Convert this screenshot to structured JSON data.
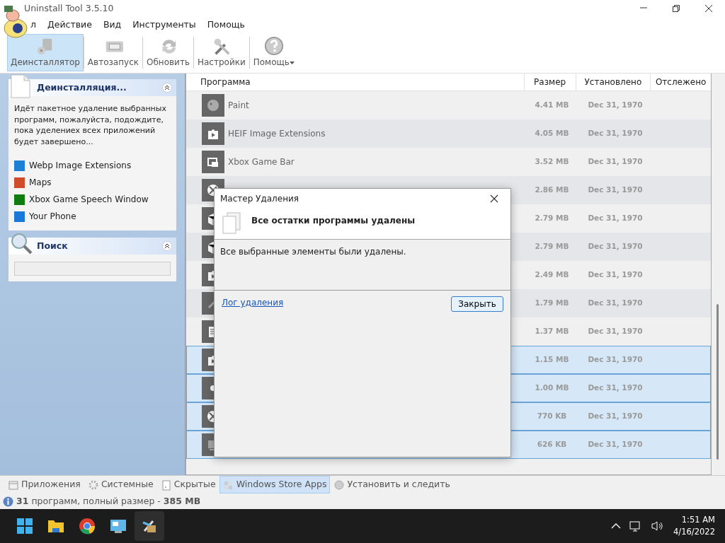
{
  "window": {
    "title": "Uninstall Tool 3.5.10"
  },
  "menu": [
    "л",
    "Действие",
    "Вид",
    "Инструменты",
    "Помощь"
  ],
  "toolbar": [
    {
      "label": "Деинсталлятор",
      "kind": "uninstaller",
      "selected": true
    },
    {
      "label": "Автозапуск",
      "kind": "autorun",
      "selected": false
    },
    {
      "label": "Обновить",
      "kind": "refresh",
      "selected": false
    },
    {
      "label": "Настройки",
      "kind": "settings",
      "selected": false
    },
    {
      "label": "Помощь",
      "kind": "help",
      "selected": false,
      "dropdown": true
    }
  ],
  "sidebar": {
    "progress_panel": {
      "title": "Деинсталляция...",
      "message": "Идёт пакетное удаление выбранных программ, пожалуйста, подождите, пока уделениех всех приложений будет завершено...",
      "items": [
        {
          "name": "Webp Image Extensions",
          "color": "#1e7fd6"
        },
        {
          "name": "Maps",
          "color": "#d04a2c"
        },
        {
          "name": "Xbox Game Speech Window",
          "color": "#107c10"
        },
        {
          "name": "Your Phone",
          "color": "#1a78d6"
        }
      ]
    },
    "search_panel": {
      "title": "Поиск"
    }
  },
  "table": {
    "columns": [
      "Программа",
      "Размер",
      "Установлено",
      "Отслежено"
    ],
    "rows": [
      {
        "kind": "palette",
        "name": "Paint",
        "size": "4.41 MB",
        "installed": "Dec 31, 1970",
        "selected": false
      },
      {
        "kind": "puzzle",
        "name": "HEIF Image Extensions",
        "size": "4.05 MB",
        "installed": "Dec 31, 1970",
        "selected": false
      },
      {
        "kind": "gamebar",
        "name": "Xbox Game Bar",
        "size": "3.52 MB",
        "installed": "Dec 31, 1970",
        "selected": false
      },
      {
        "kind": "xbox",
        "size": "2.86 MB",
        "installed": "Dec 31, 1970",
        "selected": false
      },
      {
        "kind": "box",
        "size": "2.79 MB",
        "installed": "Dec 31, 1970",
        "selected": false
      },
      {
        "kind": "box",
        "size": "2.79 MB",
        "installed": "Dec 31, 1970",
        "selected": false
      },
      {
        "kind": "puzzle",
        "size": "2.49 MB",
        "installed": "Dec 31, 1970",
        "selected": false
      },
      {
        "kind": "tool",
        "size": "1.79 MB",
        "installed": "Dec 31, 1970",
        "selected": false
      },
      {
        "kind": "notes",
        "size": "1.37 MB",
        "installed": "Dec 31, 1970",
        "selected": false
      },
      {
        "kind": "puzzle",
        "size": "1.15 MB",
        "installed": "Dec 31, 1970",
        "selected": true
      },
      {
        "kind": "dot",
        "size": "1.00 MB",
        "installed": "Dec 31, 1970",
        "selected": true
      },
      {
        "kind": "xbox",
        "size": "770 KB",
        "installed": "Dec 31, 1970",
        "selected": true
      },
      {
        "kind": "screen",
        "size": "626 KB",
        "installed": "Dec 31, 1970",
        "selected": true
      }
    ]
  },
  "dialog": {
    "title": "Мастер Удаления",
    "heading": "Все остатки программы удалены",
    "message": "Все выбранные элементы были удалены.",
    "link": "Лог удаления",
    "button": "Закрыть"
  },
  "bottom_tabs": [
    {
      "label": "Приложения",
      "kind": "apps",
      "selected": false
    },
    {
      "label": "Системные",
      "kind": "system",
      "selected": false
    },
    {
      "label": "Скрытые",
      "kind": "hidden",
      "selected": false
    },
    {
      "label": "Windows Store Apps",
      "kind": "store",
      "selected": true
    },
    {
      "label": "Установить и следить",
      "kind": "install",
      "selected": false
    }
  ],
  "status_bar": "**31** программ, полный размер - **385 MB**",
  "taskbar": {
    "apps": [
      {
        "kind": "start",
        "active": false
      },
      {
        "kind": "explorer",
        "active": false
      },
      {
        "kind": "browser",
        "active": false
      },
      {
        "kind": "control",
        "active": false
      },
      {
        "kind": "uninstall",
        "active": true
      }
    ],
    "time": "1:51 AM",
    "date": "4/16/2022"
  }
}
